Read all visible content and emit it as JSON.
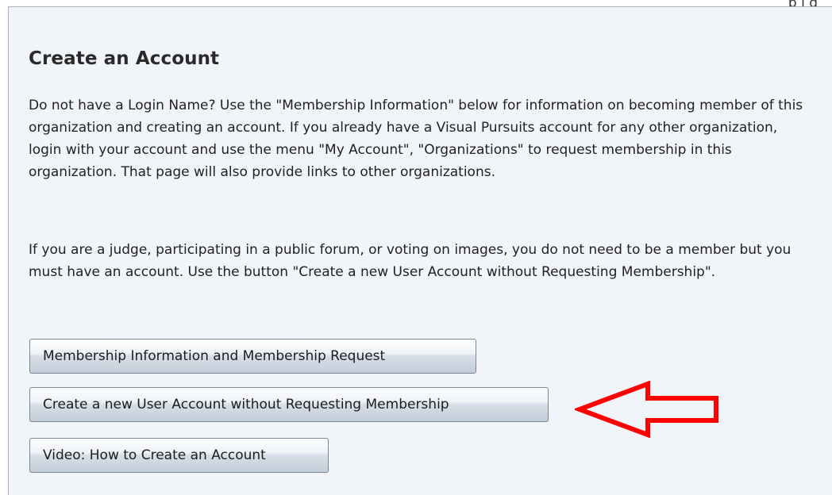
{
  "page": {
    "clipped_top_text": "p   i g"
  },
  "create_account": {
    "title": "Create an Account",
    "paragraph_1": "Do not have a Login Name? Use the \"Membership Information\" below for information on becoming member of this organization and creating an account. If you already have a Visual Pursuits account for any other organization, login with your account and use the menu \"My Account\", \"Organizations\" to request membership in this organization. That page will also provide links to other organizations.",
    "paragraph_2": "If you are a judge, participating in a public forum, or voting on images, you do not need to be a member but you must have an account. Use the button \"Create a new User Account without Requesting Membership\".",
    "buttons": [
      {
        "label": "Membership Information and Membership Request"
      },
      {
        "label": "Create a new User Account without Requesting Membership"
      },
      {
        "label": "Video: How to Create an Account"
      }
    ]
  },
  "annotation": {
    "arrow_color": "#ff0000",
    "arrow_direction": "left"
  },
  "colors": {
    "panel_background": "#f1f4f9",
    "panel_border": "#a7b3c3",
    "button_border": "#7a8797"
  }
}
